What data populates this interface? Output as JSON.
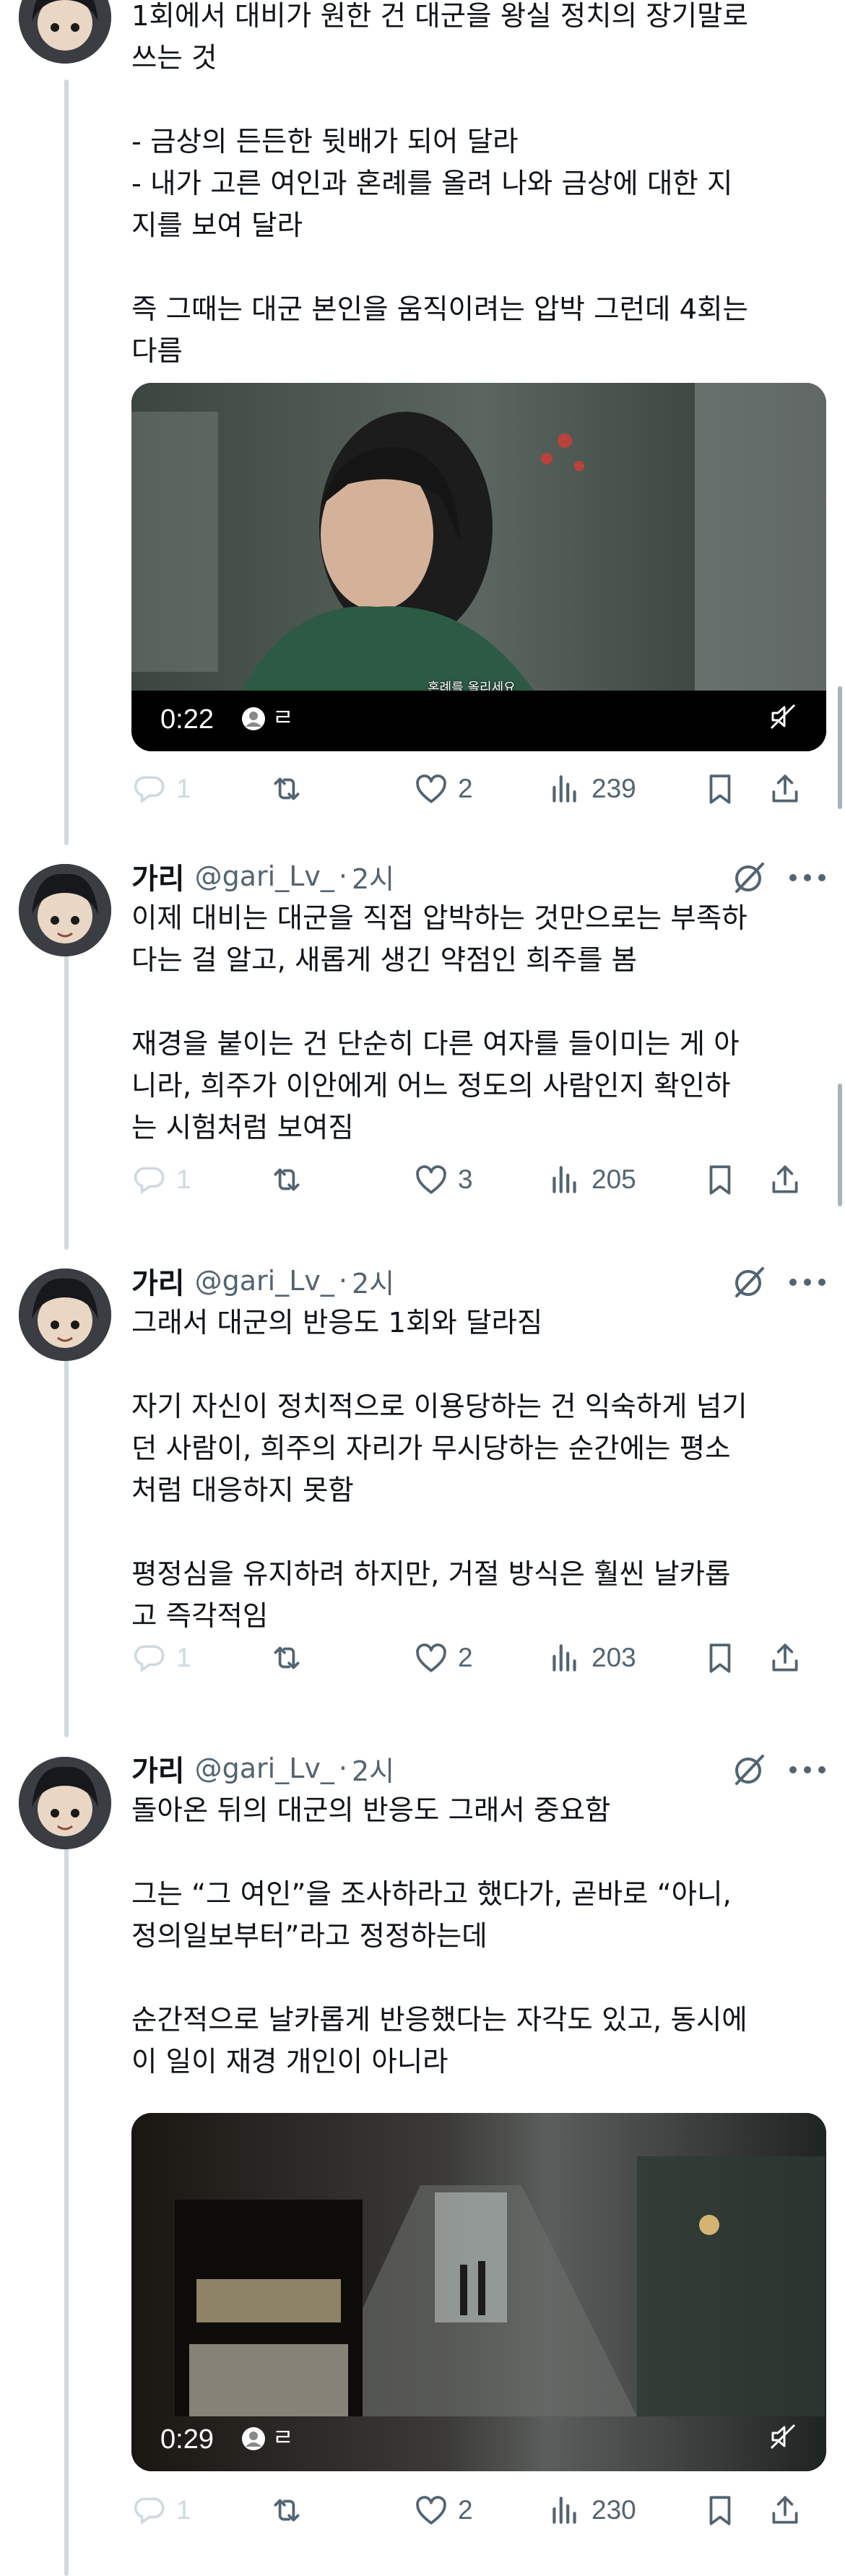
{
  "tweets": [
    {
      "text": "1회에서 대비가 원한 건 대군을 왕실 정치의 장기말로\n쓰는 것\n\n- 금상의 든든한 뒷배가 되어 달라\n- 내가 고른 여인과 혼례를 올려 나와 금상에 대한 지\n지를 보여 달라\n\n즉 그때는 대군 본인을 움직이려는 압박 그런데 4회는\n다름",
      "video": {
        "time": "0:22",
        "char": "ㄹ",
        "subtitle": "혼례를 올리세요"
      },
      "actions": {
        "replies": "1",
        "likes": "2",
        "views": "239"
      }
    },
    {
      "name": "가리",
      "handle": "@gari_Lv_",
      "separator": "·",
      "time": "2시",
      "text": "이제 대비는 대군을 직접 압박하는 것만으로는 부족하\n다는 걸 알고, 새롭게 생긴 약점인 희주를 봄\n\n재경을 붙이는 건 단순히 다른 여자를 들이미는 게 아\n니라, 희주가 이안에게 어느 정도의 사람인지 확인하\n는 시험처럼 보여짐",
      "actions": {
        "replies": "1",
        "likes": "3",
        "views": "205"
      }
    },
    {
      "name": "가리",
      "handle": "@gari_Lv_",
      "separator": "·",
      "time": "2시",
      "text": "그래서 대군의 반응도 1회와 달라짐\n\n자기 자신이 정치적으로 이용당하는 건 익숙하게 넘기\n던 사람이, 희주의 자리가 무시당하는 순간에는 평소\n처럼 대응하지 못함\n\n평정심을 유지하려 하지만, 거절 방식은 훨씬 날카롭\n고 즉각적임",
      "actions": {
        "replies": "1",
        "likes": "2",
        "views": "203"
      }
    },
    {
      "name": "가리",
      "handle": "@gari_Lv_",
      "separator": "·",
      "time": "2시",
      "text": "돌아온 뒤의 대군의 반응도 그래서 중요함\n\n그는 “그 여인”을 조사하라고 했다가, 곧바로 “아니,\n정의일보부터”라고 정정하는데\n\n순간적으로 날카롭게 반응했다는 자각도 있고, 동시에\n이 일이 재경 개인이 아니라",
      "video": {
        "time": "0:29",
        "char": "ㄹ"
      },
      "actions": {
        "replies": "1",
        "likes": "2",
        "views": "230"
      }
    }
  ],
  "colors": {
    "text": "#0f1419",
    "muted": "#536471",
    "thread": "#cfd9de"
  },
  "icons": [
    "reply-icon",
    "retweet-icon",
    "like-icon",
    "views-icon",
    "bookmark-icon",
    "share-icon",
    "grok-icon",
    "more-icon",
    "mute-icon"
  ]
}
